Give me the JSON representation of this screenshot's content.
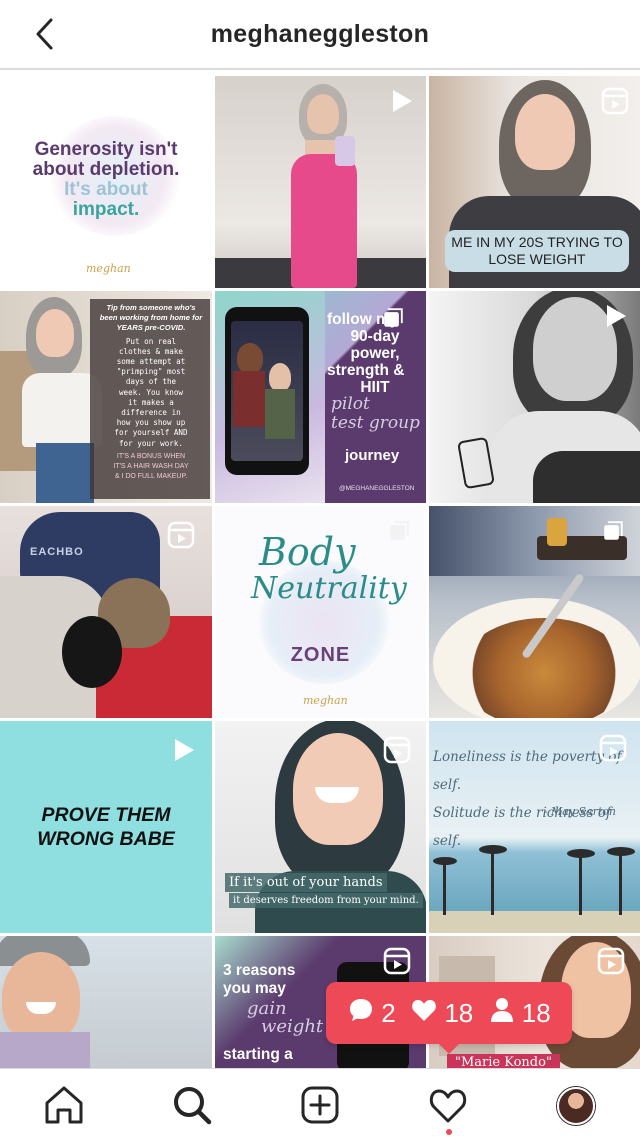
{
  "header": {
    "username": "meghaneggleston"
  },
  "posts": [
    {
      "lines": [
        "Generosity isn't",
        "about depletion.",
        "It's about",
        "impact."
      ],
      "signature": "meghan"
    },
    {},
    {
      "caption": [
        "ME IN MY 20S TRYING TO",
        "LOSE WEIGHT"
      ]
    },
    {
      "text": [
        "Tip from someone who's",
        "been working from home for",
        "YEARS pre-COVID.",
        "Put on real",
        "clothes & make",
        "some attempt at",
        "\"primping\" most",
        "days of the",
        "week. You know",
        "it makes a",
        "difference in",
        "how you show up",
        "for yourself AND",
        "for your work.",
        "IT'S A BONUS WHEN",
        "IT'S A HAIR WASH DAY",
        "& I DO FULL MAKEUP."
      ]
    },
    {
      "lines": [
        "follow my",
        "90-day",
        "power,",
        "strength &",
        "HIIT"
      ],
      "script": [
        "pilot",
        "test group"
      ],
      "journey": "journey",
      "handle": "@MEGHANEGGLESTON"
    },
    {},
    {},
    {
      "script": [
        "Body",
        "Neutrality"
      ],
      "zone": "ZONE",
      "signature": "meghan"
    },
    {},
    {
      "lines": [
        "PROVE THEM",
        "WRONG BABE"
      ]
    },
    {
      "caption": [
        "If it's out of your hands",
        "it deserves freedom from your mind."
      ]
    },
    {
      "quote": [
        "Loneliness is the poverty of self.",
        "Solitude is the richness of self."
      ],
      "author": "- May Sarton"
    },
    {},
    {
      "lines": [
        "3 reasons",
        "you may"
      ],
      "script": [
        "gain",
        "weight"
      ],
      "tail": "starting a"
    },
    {
      "caption": "\"Marie Kondo\""
    }
  ],
  "activity": {
    "comments": "2",
    "likes": "18",
    "follows": "18"
  },
  "icons": {
    "back": "chevron-left-icon",
    "video": "play-icon",
    "reel": "reel-icon",
    "carousel": "carousel-icon",
    "home": "home-icon",
    "search": "search-icon",
    "add": "add-post-icon",
    "activity": "heart-icon"
  },
  "colors": {
    "accent": "#ed4956",
    "text": "#262626",
    "border": "#dbdbdb"
  }
}
